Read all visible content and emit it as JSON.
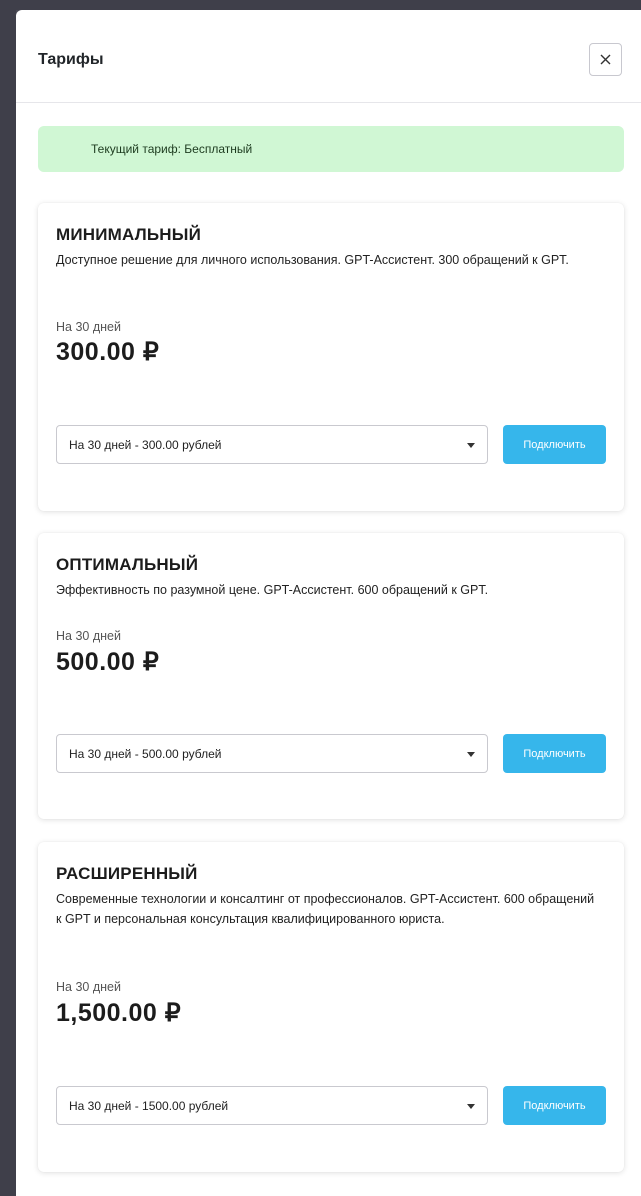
{
  "modal": {
    "title": "Тарифы"
  },
  "current_plan": {
    "text": "Текущий тариф: Бесплатный"
  },
  "plans": [
    {
      "name": "МИНИМАЛЬНЫЙ",
      "description": "Доступное решение для личного использования. GPT-Ассистент. 300 обращений к GPT.",
      "period_label": "На 30 дней",
      "price": "300.00 ₽",
      "selected_option": "На 30 дней - 300.00 рублей",
      "button_label": "Подключить"
    },
    {
      "name": "ОПТИМАЛЬНЫЙ",
      "description": "Эффективность по разумной цене. GPT-Ассистент. 600 обращений к GPT.",
      "period_label": "На 30 дней",
      "price": "500.00 ₽",
      "selected_option": "На 30 дней - 500.00 рублей",
      "button_label": "Подключить"
    },
    {
      "name": "РАСШИРЕННЫЙ",
      "description": "Современные технологии и консалтинг от профессионалов. GPT-Ассистент. 600 обращений к GPT и персональная консультация квалифицированного юриста.",
      "period_label": "На 30 дней",
      "price": "1,500.00 ₽",
      "selected_option": "На 30 дней - 1500.00 рублей",
      "button_label": "Подключить"
    }
  ],
  "colors": {
    "accent": "#36b6eb",
    "alert_bg": "#d0f7d4"
  }
}
